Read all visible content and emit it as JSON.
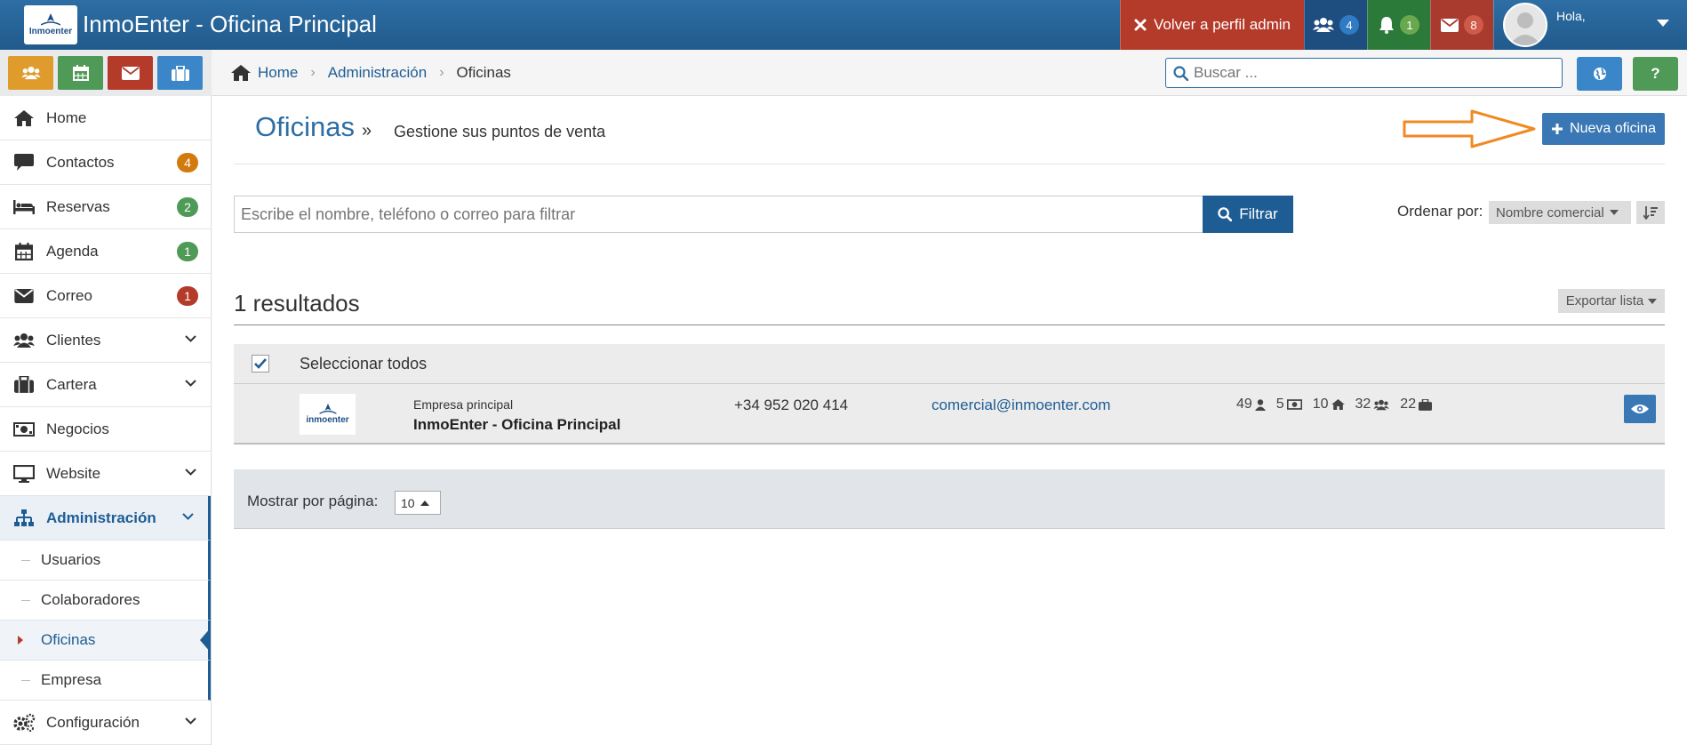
{
  "header": {
    "logo_text": "Inmoenter",
    "app_title": "InmoEnter - Oficina Principal",
    "admin_button": "Volver a perfil admin",
    "users_count": "4",
    "notifications_count": "1",
    "messages_count": "8",
    "greeting": "Hola,"
  },
  "breadcrumb": {
    "home": "Home",
    "section": "Administración",
    "current": "Oficinas"
  },
  "search": {
    "placeholder": "Buscar ..."
  },
  "help_label": "?",
  "sidebar": {
    "items": [
      {
        "label": "Home"
      },
      {
        "label": "Contactos",
        "badge": "4"
      },
      {
        "label": "Reservas",
        "badge": "2"
      },
      {
        "label": "Agenda",
        "badge": "1"
      },
      {
        "label": "Correo",
        "badge": "1"
      },
      {
        "label": "Clientes"
      },
      {
        "label": "Cartera"
      },
      {
        "label": "Negocios"
      },
      {
        "label": "Website"
      },
      {
        "label": "Administración"
      },
      {
        "label": "Configuración"
      }
    ],
    "admin_subitems": [
      {
        "label": "Usuarios"
      },
      {
        "label": "Colaboradores"
      },
      {
        "label": "Oficinas"
      },
      {
        "label": "Empresa"
      }
    ]
  },
  "page": {
    "title": "Oficinas",
    "separator": "»",
    "subtitle": "Gestione sus puntos de venta",
    "new_button": "Nueva oficina"
  },
  "filter": {
    "placeholder": "Escribe el nombre, teléfono o correo para filtrar",
    "button": "Filtrar",
    "order_label": "Ordenar por:",
    "order_value": "Nombre comercial"
  },
  "results": {
    "count_text": "1 resultados",
    "export_button": "Exportar lista",
    "select_all": "Seleccionar todos",
    "rows": [
      {
        "logo_text": "inmoenter",
        "type": "Empresa principal",
        "name": "InmoEnter - Oficina Principal",
        "phone": "+34 952 020 414",
        "email": "comercial@inmoenter.com",
        "stats": {
          "users": "49",
          "money": "5",
          "homes": "10",
          "groups": "32",
          "cases": "22"
        }
      }
    ]
  },
  "pager": {
    "label": "Mostrar por página:",
    "value": "10"
  },
  "colors": {
    "primary": "#1e5d94",
    "admin_red": "#b43a2a",
    "orange_arrow": "#f08a24",
    "badge_orange": "#d27a0e",
    "badge_green": "#4f9a57",
    "badge_red": "#b43a2a"
  },
  "icons": {
    "home": "home-icon",
    "users": "users-icon",
    "bell": "bell-icon",
    "mail": "envelope-icon",
    "calendar": "calendar-icon",
    "briefcase": "briefcase-icon",
    "globe": "globe-icon",
    "search": "search-icon",
    "eye": "eye-icon"
  }
}
